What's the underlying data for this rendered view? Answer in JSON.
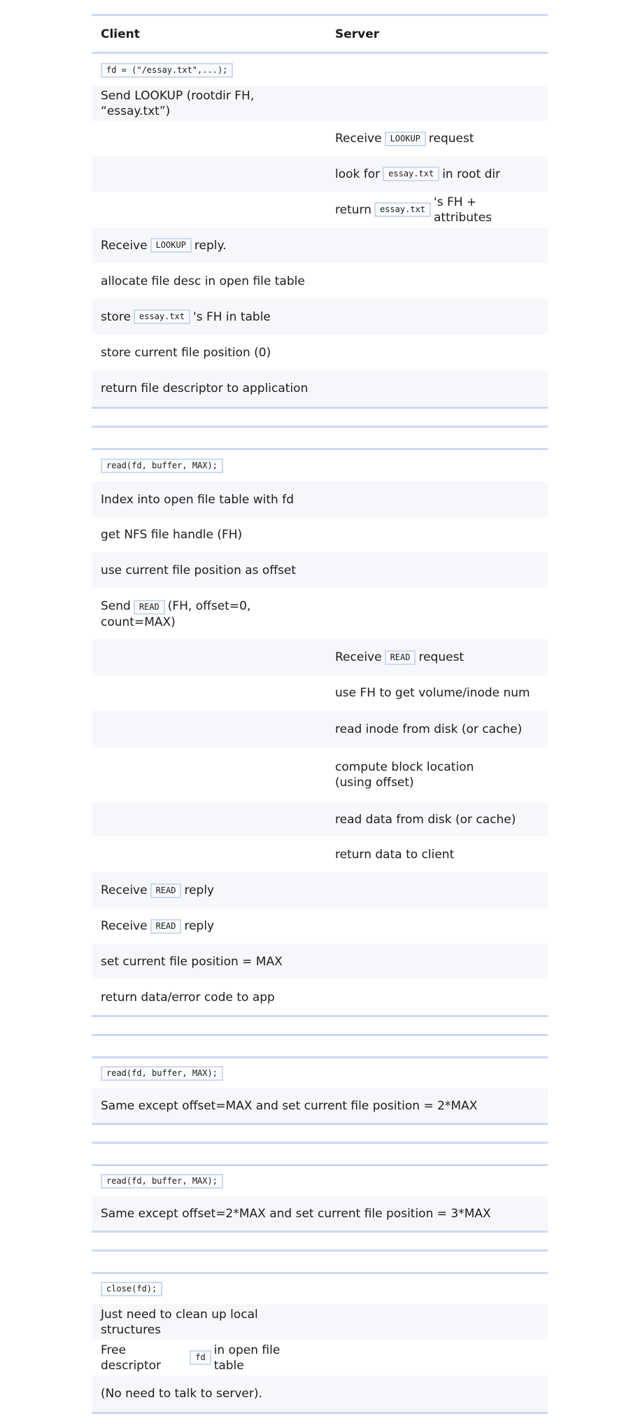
{
  "header": {
    "client": "Client",
    "server": "Server"
  },
  "open_section": {
    "call": "fd = (\"/essay.txt\",...);",
    "send_lookup": "Send LOOKUP (rootdir FH, “essay.txt”)",
    "srv_receive_pre": "Receive",
    "srv_receive_code": "LOOKUP",
    "srv_receive_post": "request",
    "srv_look_pre": "look for",
    "srv_look_code": "essay.txt",
    "srv_look_post": "in root dir",
    "srv_return_pre": "return",
    "srv_return_code": "essay.txt",
    "srv_return_post": "'s FH + attributes",
    "cl_receive_pre": "Receive",
    "cl_receive_code": "LOOKUP",
    "cl_receive_post": "reply.",
    "allocate": "allocate file desc in open file table",
    "store_pre": "store",
    "store_code": "essay.txt",
    "store_post": "'s FH in table",
    "store_pos": "store current file position (0)",
    "return_fd": "return file descriptor to application"
  },
  "read_section": {
    "call": "read(fd, buffer, MAX);",
    "index": "Index into open file table with fd",
    "get_fh": "get NFS file handle (FH)",
    "use_pos": "use current file position as offset",
    "send_pre": "Send",
    "send_code": "READ",
    "send_post": "(FH, offset=0, count=MAX)",
    "srv_receive_pre": "Receive",
    "srv_receive_code": "READ",
    "srv_receive_post": "request",
    "srv_use_fh": "use FH to get volume/inode num",
    "srv_read_inode": "read inode from disk (or cache)",
    "srv_compute": "compute block location (using offset)",
    "srv_read_data": "read data from disk (or cache)",
    "srv_return": "return data to client",
    "cl_receive1_pre": "Receive",
    "cl_receive1_code": "READ",
    "cl_receive1_post": "reply",
    "cl_receive2_pre": "Receive",
    "cl_receive2_code": "READ",
    "cl_receive2_post": "reply",
    "set_pos": "set current file position = MAX",
    "return_data": "return data/error code to app"
  },
  "read2_section": {
    "call": "read(fd, buffer, MAX);",
    "text": "Same except offset=MAX and set current file position = 2*MAX"
  },
  "read3_section": {
    "call": "read(fd, buffer, MAX);",
    "text": "Same except offset=2*MAX and set current file position = 3*MAX"
  },
  "close_section": {
    "call": "close(fd);",
    "cleanup": "Just need to clean up local structures",
    "free_pre": "Free descriptor",
    "free_code": "fd",
    "free_post": "in open file table",
    "no_need": "(No need to talk to server)."
  }
}
